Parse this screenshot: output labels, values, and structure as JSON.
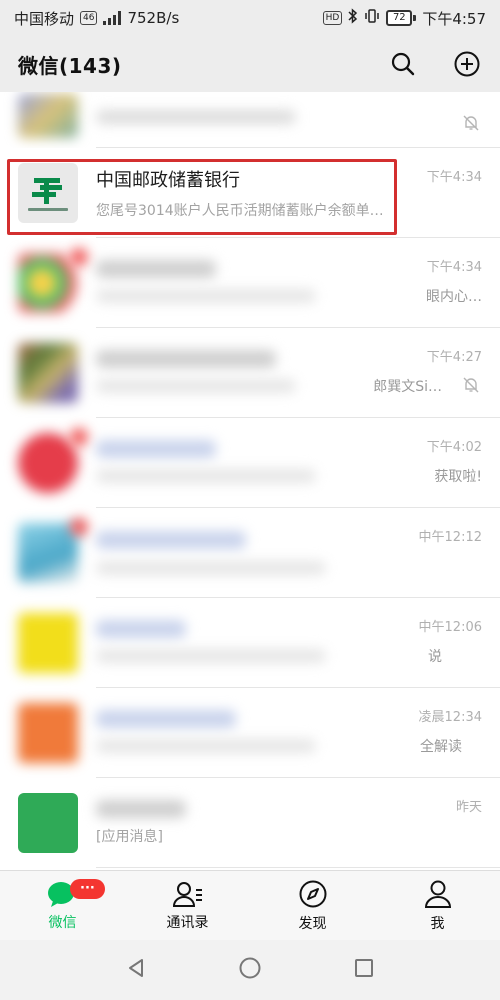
{
  "status": {
    "carrier": "中国移动",
    "net": "46",
    "speed": "752B/s",
    "hd": "HD",
    "battery": "72",
    "time": "下午4:57"
  },
  "header": {
    "title": "微信(143)"
  },
  "chats": [
    {
      "name": "中国邮政储蓄银行",
      "preview": "您尾号3014账户人民币活期储蓄账户余额单…",
      "time": "下午4:34"
    },
    {
      "preview_tail": "眼内心…",
      "time": "下午4:34"
    },
    {
      "preview_tail": "郎巽文Si…",
      "time": "下午4:27"
    },
    {
      "preview_tail": "获取啦!",
      "time": "下午4:02"
    },
    {
      "time": "中午12:12"
    },
    {
      "preview_tail": "说",
      "time": "中午12:06"
    },
    {
      "preview_tail": "全解读",
      "time": "凌晨12:34"
    },
    {
      "preview": "[应用消息]",
      "time": "昨天"
    }
  ],
  "tabbar": {
    "chats": "微信",
    "contacts": "通讯录",
    "discover": "发现",
    "me": "我",
    "badge": "···"
  },
  "colors": {
    "accent": "#07c160",
    "highlight": "#d32f2f",
    "badge": "#f43530"
  }
}
